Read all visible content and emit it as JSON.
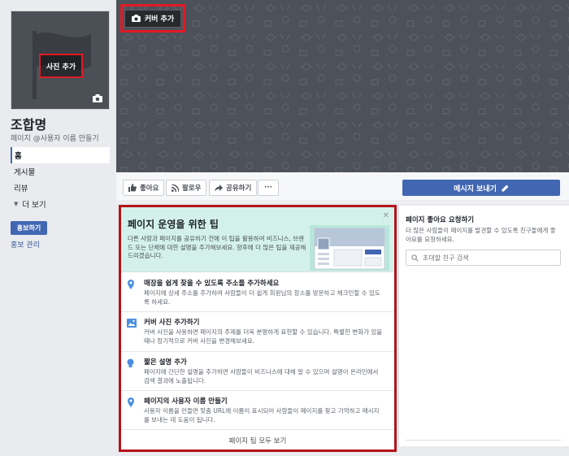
{
  "profile": {
    "add_photo_label": "사진 추가",
    "page_name": "조합명",
    "username_link": "페이지 @사용자 이름 만들기"
  },
  "nav": {
    "items": [
      {
        "label": "홈"
      },
      {
        "label": "게시물"
      },
      {
        "label": "리뷰"
      },
      {
        "label": "더 보기"
      }
    ]
  },
  "promote": {
    "button_label": "홍보하기",
    "manage_label": "홍보 관리"
  },
  "cover": {
    "add_cover_label": "커버 추가"
  },
  "action_bar": {
    "like_label": "좋아요",
    "follow_label": "팔로우",
    "share_label": "공유하기",
    "more_label": "···",
    "send_message_label": "메시지 보내기"
  },
  "tips": {
    "title": "페이지 운영을 위한 팁",
    "description": "다른 사람과 페이지를 공유하기 전에 이 팁을 활용하여 비즈니스, 브랜드 또는 단체에 대한 설명을 추가해보세요. 향후에 더 많은 팁을 제공해드리겠습니다.",
    "items": [
      {
        "title": "매장을 쉽게 찾을 수 있도록 주소를 추가하세요",
        "body": "페이지에 상세 주소를 추가하여 사람들이 더 쉽게 회원님의 장소를 방문하고 체크인할 수 있도록 하세요."
      },
      {
        "title": "커버 사진 추가하기",
        "body": "커버 사진을 사용하면 페이지의 주제를 더욱 분명하게 표현할 수 있습니다. 특별한 변화가 있을 때나 정기적으로 커버 사진을 변경해보세요."
      },
      {
        "title": "짧은 설명 추가",
        "body": "페이지에 간단한 설명을 추가하면 사람들이 비즈니스에 대해 알 수 있으며 설명이 온라인에서 검색 결과에 노출됩니다."
      },
      {
        "title": "페이지의 사용자 이름 만들기",
        "body": "사용자 이름을 만들면 맞춤 URL에 이름이 표시되어 사람들이 페이지를 찾고 기억하고 메시지를 보내는 데 도움이 됩니다."
      }
    ],
    "footer_label": "페이지 팁 모두 보기",
    "close_label": "✕"
  },
  "invite": {
    "title": "페이지 좋아요 요청하기",
    "description": "더 많은 사람들이 페이지를 발견할 수 있도록 친구들에게 좋아요를 요청하세요.",
    "search_placeholder": "초대할 친구 검색"
  },
  "colors": {
    "fb_blue": "#4267b2",
    "highlight_red": "#e01b24",
    "tips_header_bg": "#d3f1ea",
    "cover_bg": "#4d515a"
  }
}
